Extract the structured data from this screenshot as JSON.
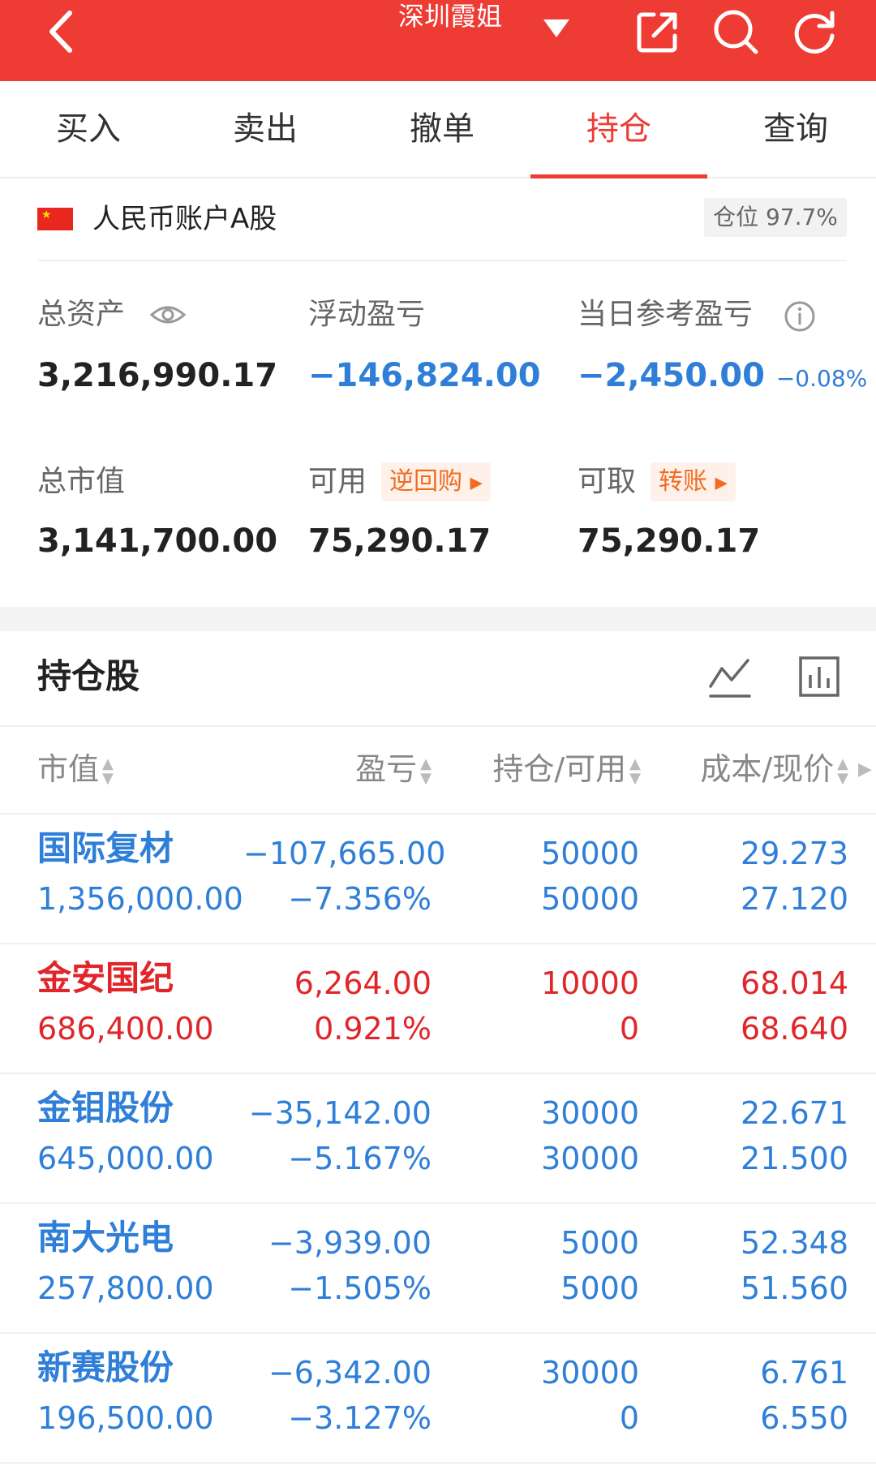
{
  "header": {
    "title": "深圳霞姐",
    "icons": {
      "back": "chevron-left-icon",
      "dropdown": "triangle-down-icon",
      "share": "external-link-icon",
      "search": "search-icon",
      "refresh": "refresh-icon"
    },
    "background_color": "#ee3b33"
  },
  "tabs": [
    {
      "label": "买入"
    },
    {
      "label": "卖出"
    },
    {
      "label": "撤单"
    },
    {
      "label": "持仓",
      "active": true
    },
    {
      "label": "查询"
    }
  ],
  "account": {
    "flag": "china-flag-icon",
    "name": "人民币账户A股",
    "position_label": "仓位 97.7%"
  },
  "summary": {
    "total_assets_label": "总资产",
    "total_assets": "3,216,990.17",
    "floating_pl_label": "浮动盈亏",
    "floating_pl": "−146,824.00",
    "daily_pl_label": "当日参考盈亏",
    "daily_pl": "−2,450.00",
    "daily_pl_pct": "−0.08%",
    "market_value_label": "总市值",
    "market_value": "3,141,700.00",
    "available_label": "可用",
    "available_tag": "逆回购",
    "available": "75,290.17",
    "withdrawable_label": "可取",
    "withdrawable_tag": "转账",
    "withdrawable": "75,290.17"
  },
  "holdings": {
    "title": "持仓股",
    "columns": [
      "市值",
      "盈亏",
      "持仓/可用",
      "成本/现价"
    ],
    "rows": [
      {
        "name": "国际复材",
        "market_value": "1,356,000.00",
        "pl": "−107,665.00",
        "pl_pct": "−7.356%",
        "position": "50000",
        "available": "50000",
        "cost": "29.273",
        "price": "27.120",
        "color": "#2f7fd8"
      },
      {
        "name": "金安国纪",
        "market_value": "686,400.00",
        "pl": "6,264.00",
        "pl_pct": "0.921%",
        "position": "10000",
        "available": "0",
        "cost": "68.014",
        "price": "68.640",
        "color": "#e0262a"
      },
      {
        "name": "金钼股份",
        "market_value": "645,000.00",
        "pl": "−35,142.00",
        "pl_pct": "−5.167%",
        "position": "30000",
        "available": "30000",
        "cost": "22.671",
        "price": "21.500",
        "color": "#2f7fd8"
      },
      {
        "name": "南大光电",
        "market_value": "257,800.00",
        "pl": "−3,939.00",
        "pl_pct": "−1.505%",
        "position": "5000",
        "available": "5000",
        "cost": "52.348",
        "price": "51.560",
        "color": "#2f7fd8"
      },
      {
        "name": "新赛股份",
        "market_value": "196,500.00",
        "pl": "−6,342.00",
        "pl_pct": "−3.127%",
        "position": "30000",
        "available": "0",
        "cost": "6.761",
        "price": "6.550",
        "color": "#2f7fd8"
      }
    ]
  }
}
